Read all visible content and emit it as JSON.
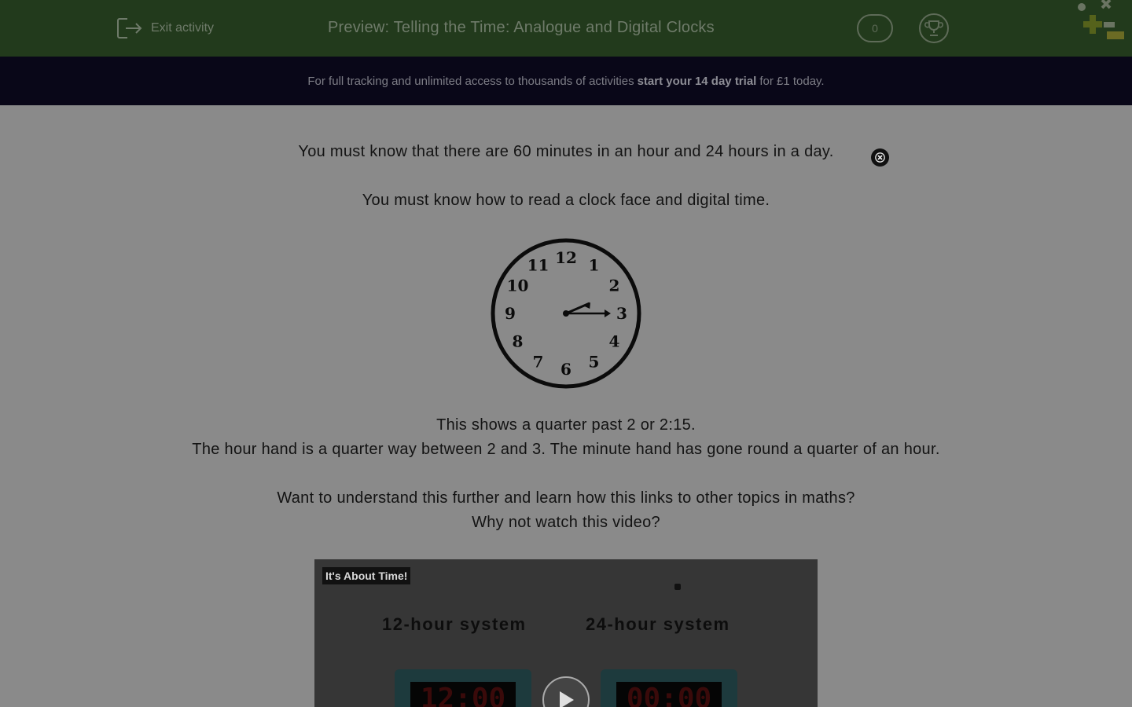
{
  "header": {
    "exit_label": "Exit activity",
    "title": "Preview: Telling the Time: Analogue and Digital Clocks",
    "score": "0"
  },
  "banner": {
    "prefix": "For full tracking and unlimited access to thousands of activities",
    "highlight": "start your 14 day trial",
    "suffix": "for £1 today."
  },
  "content": {
    "line1": "You must know that there are 60 minutes in an hour and 24 hours in a day.",
    "line2": "You must know how to read a clock face and digital time.",
    "clock_numbers": [
      "12",
      "1",
      "2",
      "3",
      "4",
      "5",
      "6",
      "7",
      "8",
      "9",
      "10",
      "11"
    ],
    "line3": "This shows a quarter past 2 or 2:15.",
    "line4": "The hour hand is a quarter way between 2 and 3. The minute hand has gone round a quarter of an hour.",
    "line5": "Want to understand this further and learn how this links to other topics in maths?",
    "line6": "Why not watch this video?"
  },
  "video": {
    "tag": "It's About Time!",
    "left_heading": "12-hour system",
    "right_heading": "24-hour system",
    "left_display": "12:00",
    "right_display": "00:00"
  },
  "colors": {
    "header_bg": "#223a1c",
    "banner_bg": "#090718",
    "content_bg": "#8a8a8a"
  }
}
